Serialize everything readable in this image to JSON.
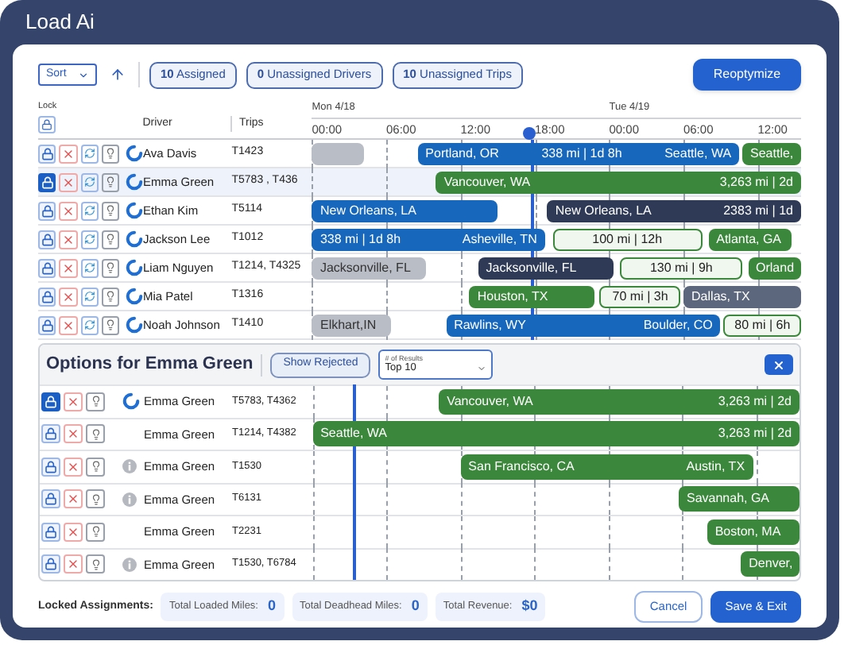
{
  "window": {
    "title": "Load Ai"
  },
  "toolbar": {
    "sort": {
      "label": "Sort"
    },
    "chips": [
      {
        "count": "10",
        "label": "Assigned"
      },
      {
        "count": "0",
        "label": "Unassigned Drivers"
      },
      {
        "count": "10",
        "label": "Unassigned Trips"
      }
    ],
    "primary_button": "Reoptymize"
  },
  "columns": {
    "lock": "Lock",
    "driver": "Driver",
    "trips": "Trips"
  },
  "timeline": {
    "days": [
      "Mon 4/18",
      "Tue 4/19"
    ],
    "times": [
      "00:00",
      "06:00",
      "12:00",
      "18:00",
      "00:00",
      "06:00",
      "12:00"
    ]
  },
  "assignments": [
    {
      "driver": "Ava Davis",
      "trips": "T1423",
      "locked": false,
      "selected": false,
      "bars": [
        {
          "kind": "solid",
          "color": "#b9bdc6"
        },
        {
          "kind": "solid",
          "color": "#1768bd",
          "labels": [
            "Portland, OR",
            "338 mi | 1d 8h",
            "Seattle, WA"
          ]
        },
        {
          "kind": "solid",
          "color": "#3b873b",
          "labels": [
            "Seattle,"
          ]
        }
      ]
    },
    {
      "driver": "Emma Green",
      "trips": "T5783 , T436",
      "locked": true,
      "selected": true,
      "bars": [
        {
          "kind": "solid",
          "color": "#3b873b",
          "labels": [
            "Vancouver, WA",
            "3,263 mi | 2d"
          ]
        }
      ]
    },
    {
      "driver": "Ethan Kim",
      "trips": "T5114",
      "locked": false,
      "selected": false,
      "bars": [
        {
          "kind": "solid",
          "color": "#1768bd",
          "labels": [
            "New Orleans, LA"
          ]
        },
        {
          "kind": "solid",
          "color": "#2e3a56",
          "labels": [
            "New Orleans, LA",
            "2383 mi | 1d"
          ]
        }
      ]
    },
    {
      "driver": "Jackson Lee",
      "trips": "T1012",
      "locked": false,
      "selected": false,
      "bars": [
        {
          "kind": "solid",
          "color": "#1768bd",
          "labels": [
            "338 mi | 1d 8h",
            "Asheville, TN"
          ]
        },
        {
          "kind": "outline",
          "color": "#3b873b",
          "labels": [
            "100 mi | 12h"
          ]
        },
        {
          "kind": "solid",
          "color": "#3b873b",
          "labels": [
            "Atlanta, GA"
          ]
        }
      ]
    },
    {
      "driver": "Liam Nguyen",
      "trips": "T1214, T4325",
      "locked": false,
      "selected": false,
      "bars": [
        {
          "kind": "solid",
          "color": "#b9bdc6",
          "labels": [
            "Jacksonville, FL"
          ]
        },
        {
          "kind": "solid",
          "color": "#2e3a56",
          "labels": [
            "Jacksonville, FL"
          ]
        },
        {
          "kind": "outline",
          "color": "#3b873b",
          "labels": [
            "130 mi | 9h"
          ]
        },
        {
          "kind": "solid",
          "color": "#3b873b",
          "labels": [
            "Orland"
          ]
        }
      ]
    },
    {
      "driver": "Mia Patel",
      "trips": "T1316",
      "locked": false,
      "selected": false,
      "bars": [
        {
          "kind": "solid",
          "color": "#3b873b",
          "labels": [
            "Houston, TX"
          ]
        },
        {
          "kind": "outline",
          "color": "#3b873b",
          "labels": [
            "70 mi | 3h"
          ]
        },
        {
          "kind": "solid",
          "color": "#5c667c",
          "labels": [
            "Dallas, TX"
          ]
        }
      ]
    },
    {
      "driver": "Noah Johnson",
      "trips": "T1410",
      "locked": false,
      "selected": false,
      "bars": [
        {
          "kind": "solid",
          "color": "#b9bdc6",
          "labels": [
            "Elkhart,IN"
          ]
        },
        {
          "kind": "solid",
          "color": "#1768bd",
          "labels": [
            "Rawlins, WY",
            "Boulder, CO"
          ]
        },
        {
          "kind": "outline",
          "color": "#3b873b",
          "labels": [
            "80 mi | 6h"
          ]
        }
      ]
    }
  ],
  "options": {
    "title": "Options for Emma Green",
    "show_rejected": "Show Rejected",
    "results": {
      "label": "# of Results",
      "value": "Top 10"
    },
    "rows": [
      {
        "driver": "Emma Green",
        "trips": "T5783, T4362",
        "locked": true,
        "kind": "spinner",
        "bars": [
          {
            "kind": "solid",
            "color": "#3b873b",
            "labels": [
              "Vancouver, WA",
              "3,263 mi | 2d"
            ]
          }
        ]
      },
      {
        "driver": "Emma Green",
        "trips": "T1214, T4382",
        "locked": false,
        "kind": "plain",
        "bars": [
          {
            "kind": "solid",
            "color": "#3b873b",
            "labels": [
              "Seattle, WA",
              "3,263 mi | 2d"
            ]
          }
        ]
      },
      {
        "driver": "Emma Green",
        "trips": "T1530",
        "locked": false,
        "kind": "info",
        "bars": [
          {
            "kind": "solid",
            "color": "#3b873b",
            "labels": [
              "San Francisco, CA",
              "Austin, TX"
            ]
          }
        ]
      },
      {
        "driver": "Emma Green",
        "trips": "T6131",
        "locked": false,
        "kind": "info",
        "bars": [
          {
            "kind": "solid",
            "color": "#3b873b",
            "labels": [
              "Savannah, GA"
            ]
          }
        ]
      },
      {
        "driver": "Emma Green",
        "trips": "T2231",
        "locked": false,
        "kind": "plain",
        "bars": [
          {
            "kind": "solid",
            "color": "#3b873b",
            "labels": [
              "Boston, MA"
            ]
          }
        ]
      },
      {
        "driver": "Emma Green",
        "trips": "T1530, T6784",
        "locked": false,
        "kind": "info",
        "bars": [
          {
            "kind": "solid",
            "color": "#3b873b",
            "labels": [
              "Denver,"
            ]
          }
        ]
      }
    ]
  },
  "footer": {
    "title": "Locked Assignments:",
    "stats": [
      {
        "label": "Total Loaded Miles:",
        "value": "0"
      },
      {
        "label": "Total Deadhead Miles:",
        "value": "0"
      },
      {
        "label": "Total Revenue:",
        "value": "$0"
      }
    ],
    "buttons": [
      {
        "label": "Cancel",
        "kind": "secondary"
      },
      {
        "label": "Save & Exit",
        "kind": "primary"
      }
    ]
  }
}
